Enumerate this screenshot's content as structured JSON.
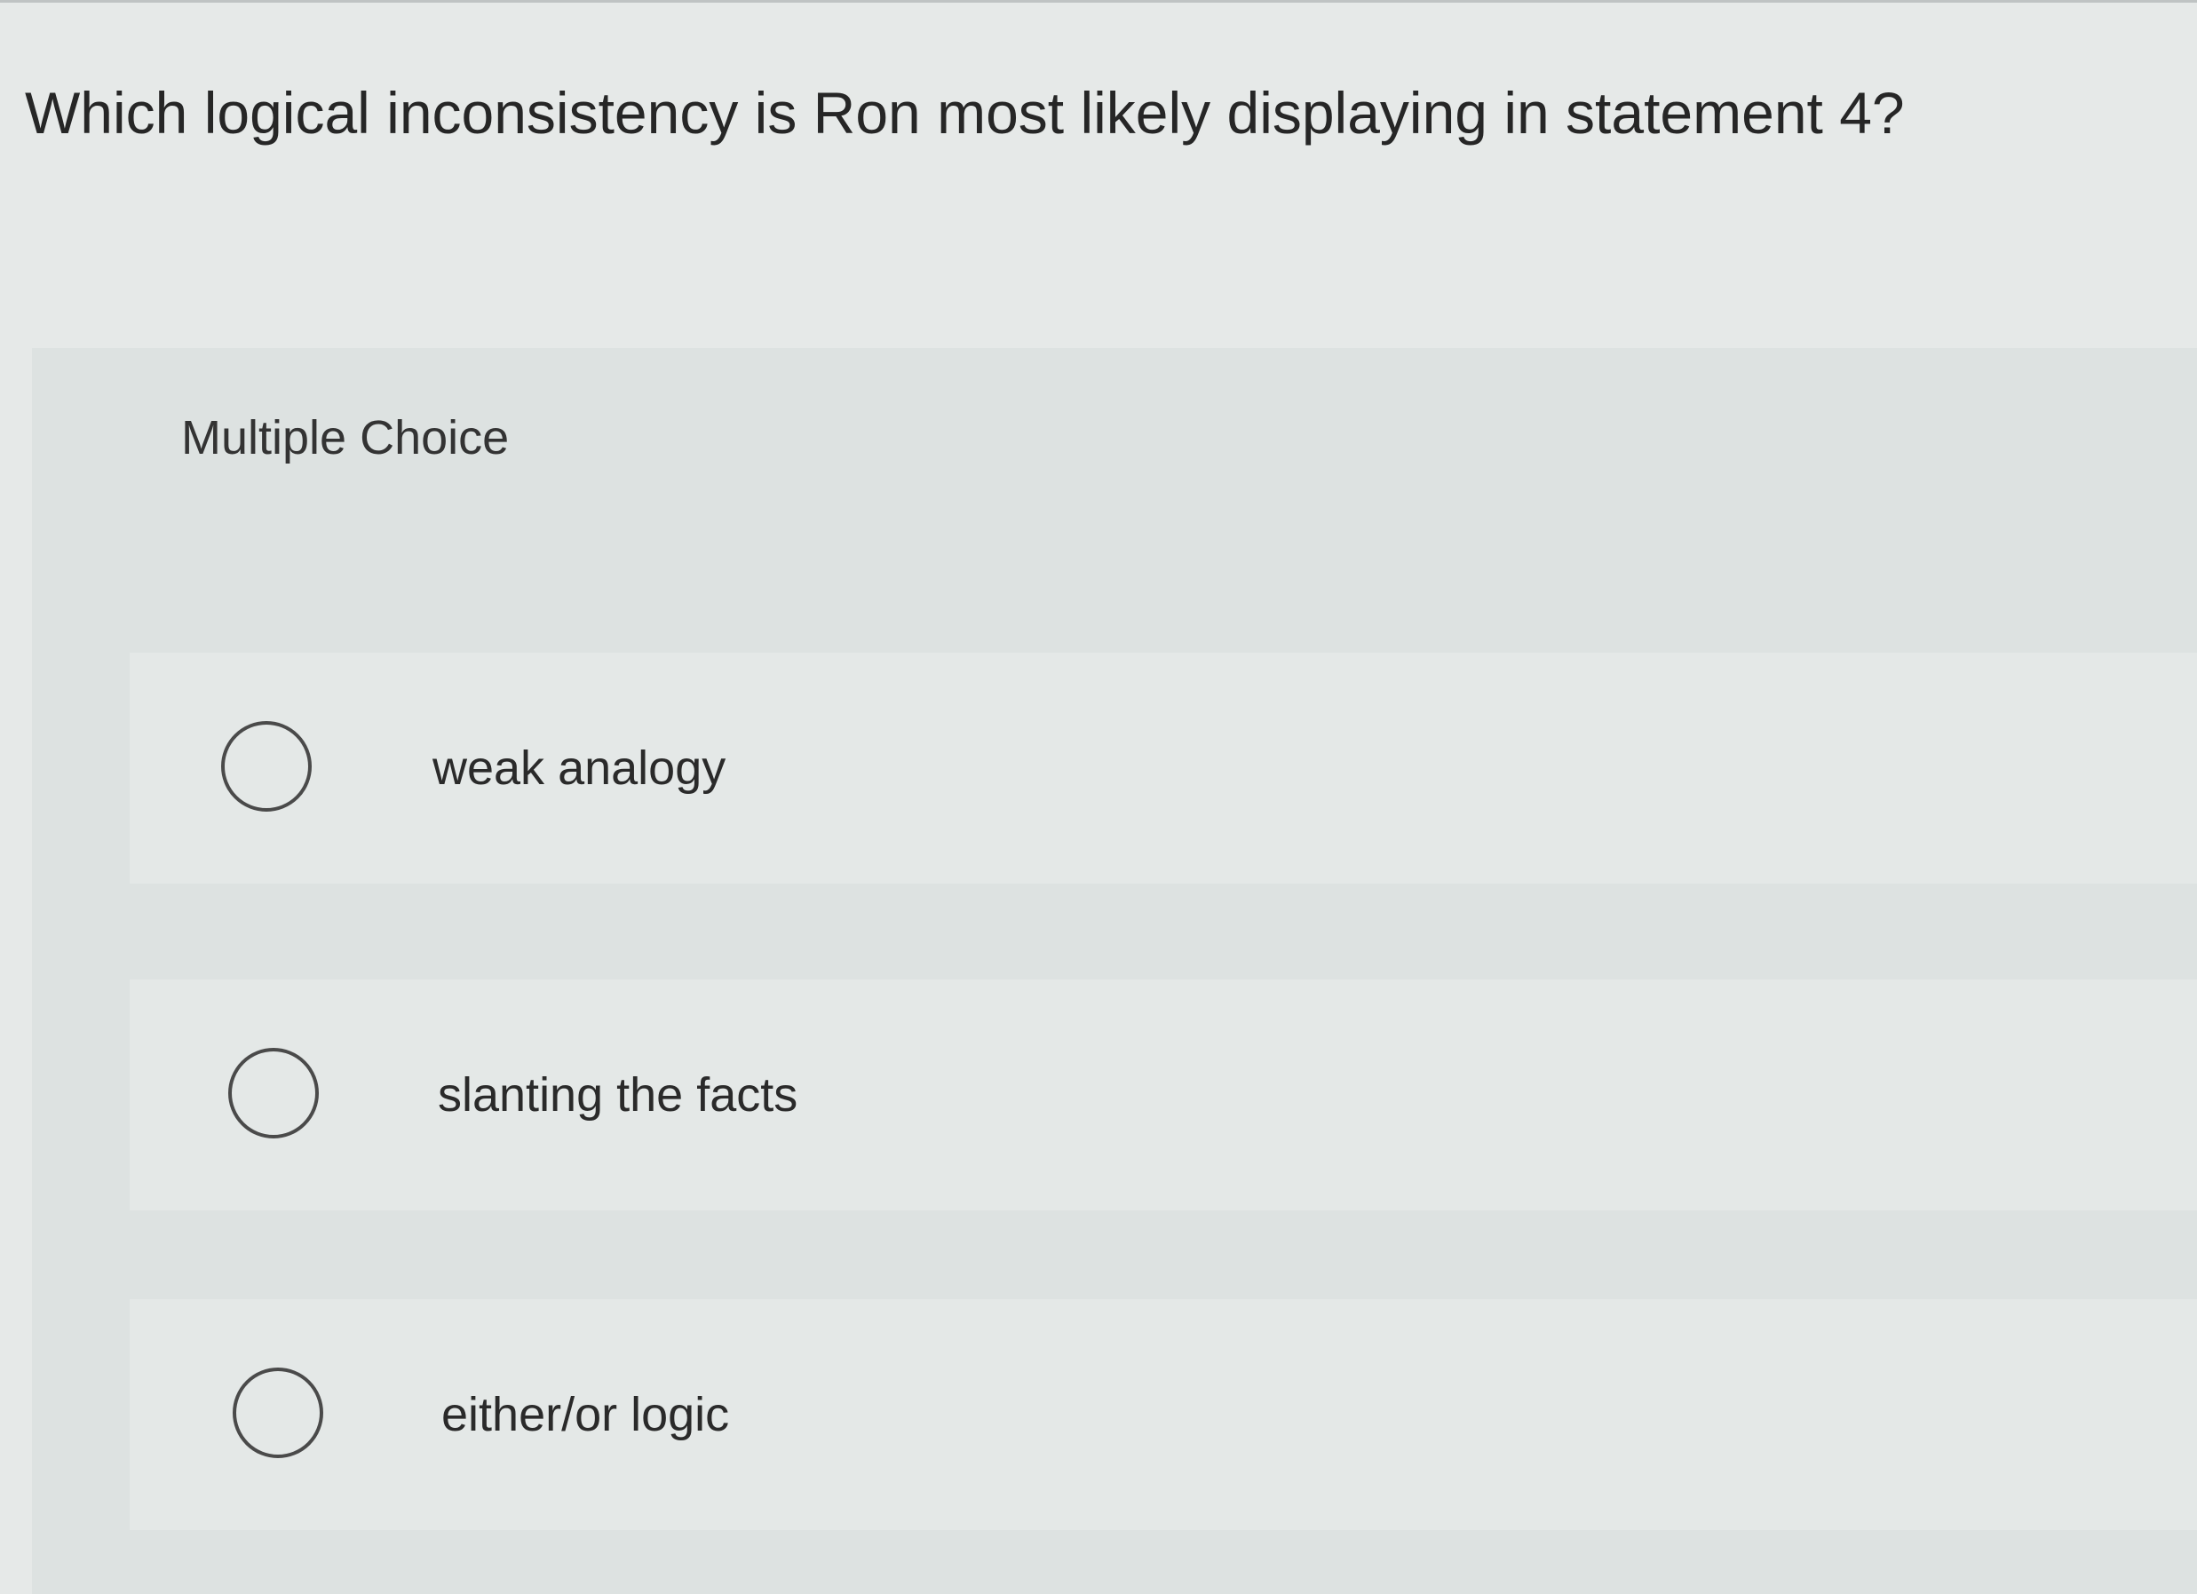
{
  "question": {
    "text": "Which logical inconsistency is Ron most likely displaying in statement 4?"
  },
  "choices": {
    "heading": "Multiple Choice",
    "options": [
      {
        "label": "weak analogy",
        "selected": false
      },
      {
        "label": "slanting the facts",
        "selected": false
      },
      {
        "label": "either/or logic",
        "selected": false
      }
    ]
  }
}
